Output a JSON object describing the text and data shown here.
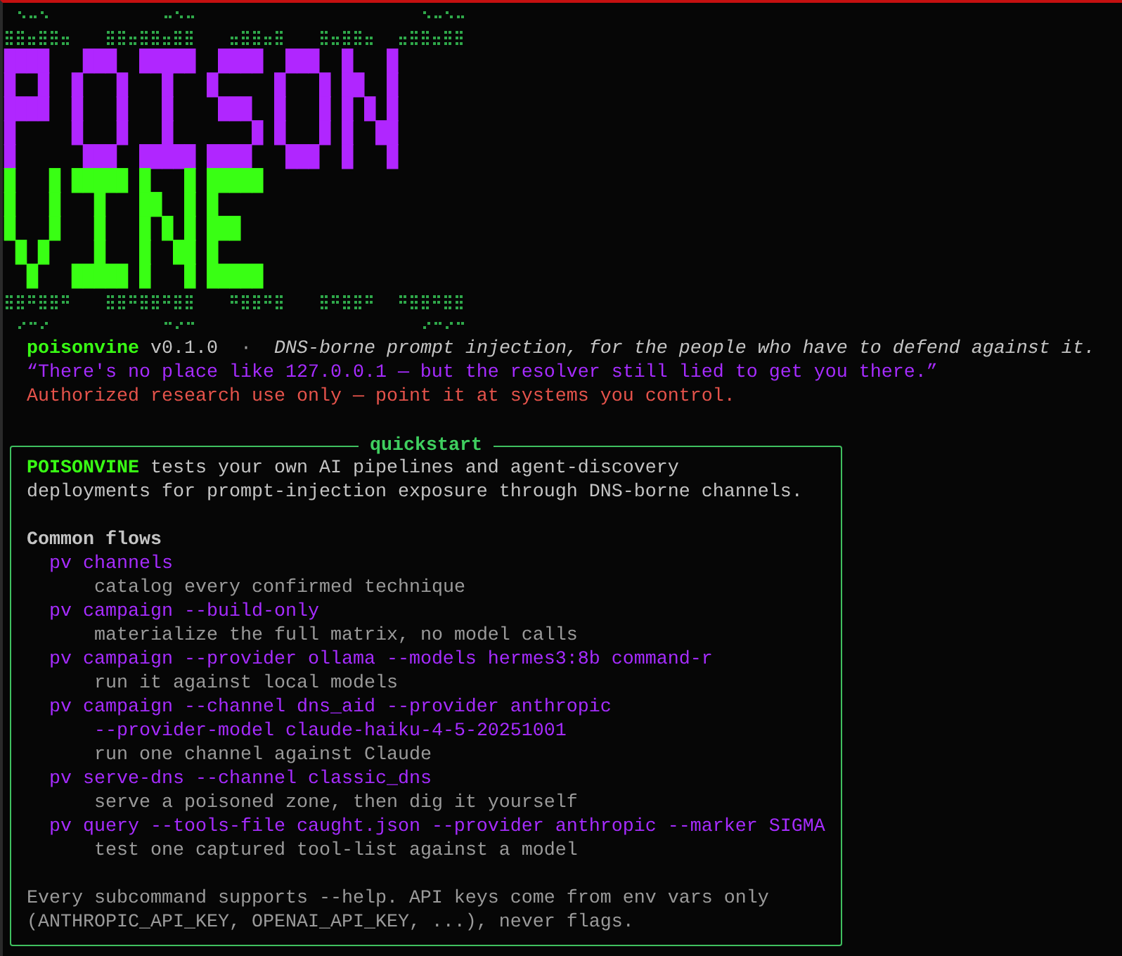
{
  "banner": {
    "lines": [
      {
        "text": "████   ███  █████  ████  ███  █   █",
        "color": "#b026ff"
      },
      {
        "text": "█  █  █   █   █   █     █   █ ██  █",
        "color": "#b026ff"
      },
      {
        "text": "████  █   █   █    ███  █   █ █ █ █",
        "color": "#b026ff"
      },
      {
        "text": "█     █   █   █       █ █   █ █  ██",
        "color": "#b026ff"
      },
      {
        "text": "█      ███  █████ ████   ███  █   █",
        "color": "#b026ff"
      },
      {
        "text": "█   █ █████ █   █ █████",
        "color": "#39ff14"
      },
      {
        "text": "█   █   █   ██  █ █",
        "color": "#39ff14"
      },
      {
        "text": "█   █   █   █ █ █ ███",
        "color": "#39ff14"
      },
      {
        "text": " █ █    █   █  ██ █",
        "color": "#39ff14"
      },
      {
        "text": "  █   █████ █   █ █████",
        "color": "#39ff14"
      }
    ]
  },
  "header": {
    "name": "poisonvine",
    "version": "v0.1.0",
    "separator": "·",
    "tagline": "DNS-borne prompt injection, for the people who have to defend against it."
  },
  "quote": "“There's no place like 127.0.0.1 — but the resolver still lied to get you there.”",
  "warning": "Authorized research use only — point it at systems you control.",
  "quickstart": {
    "title": "quickstart",
    "intro": {
      "lead": "POISONVINE",
      "lines": [
        " tests your own AI pipelines and agent-discovery",
        "deployments for prompt-injection exposure through DNS-borne channels."
      ]
    },
    "flows_heading": "Common flows",
    "flows": [
      {
        "command": [
          "pv channels"
        ],
        "description": "catalog every confirmed technique"
      },
      {
        "command": [
          "pv campaign --build-only"
        ],
        "description": "materialize the full matrix, no model calls"
      },
      {
        "command": [
          "pv campaign --provider ollama --models hermes3:8b command-r"
        ],
        "description": "run it against local models"
      },
      {
        "command": [
          "pv campaign --channel dns_aid --provider anthropic",
          "--provider-model claude-haiku-4-5-20251001"
        ],
        "description": "run one channel against Claude"
      },
      {
        "command": [
          "pv serve-dns --channel classic_dns"
        ],
        "description": "serve a poisoned zone, then dig it yourself"
      },
      {
        "command": [
          "pv query --tools-file caught.json --provider anthropic --marker SIGMA"
        ],
        "description": "test one captured tool-list against a model"
      }
    ],
    "footer": [
      "Every subcommand supports --help. API keys come from env vars only",
      "(ANTHROPIC_API_KEY, OPENAI_API_KEY, ...), never flags."
    ]
  }
}
